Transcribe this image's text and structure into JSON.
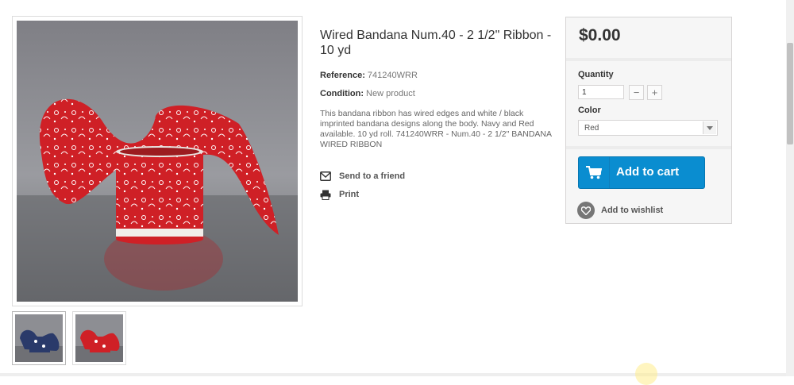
{
  "product": {
    "title": "Wired Bandana Num.40 - 2 1/2\" Ribbon - 10 yd",
    "reference_label": "Reference:",
    "reference_value": "741240WRR",
    "condition_label": "Condition:",
    "condition_value": "New product",
    "description": "This bandana ribbon has wired edges and white / black imprinted bandana designs along the body. Navy and Red available. 10 yd roll. 741240WRR - Num.40 - 2 1/2\" BANDANA WIRED RIBBON"
  },
  "actions": {
    "send_friend": "Send to a friend",
    "print": "Print"
  },
  "buy_box": {
    "price": "$0.00",
    "quantity_label": "Quantity",
    "quantity_value": "1",
    "minus": "−",
    "plus": "+",
    "color_label": "Color",
    "color_selected": "Red",
    "add_to_cart": "Add to cart",
    "add_to_wishlist": "Add to wishlist"
  },
  "colors": {
    "cart_button": "#0a8dd0",
    "ribbon_red": "#cf2026",
    "navy": "#2a3a6a"
  },
  "icons": {
    "send": "envelope-icon",
    "print": "printer-icon",
    "cart": "cart-icon",
    "wishlist": "heart-icon",
    "select": "chevron-down-icon"
  }
}
